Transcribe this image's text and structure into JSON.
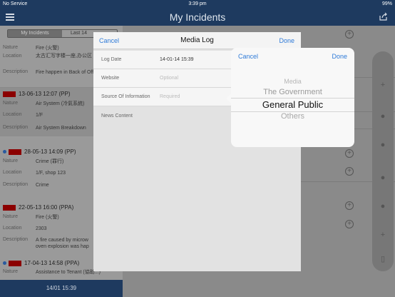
{
  "status": {
    "carrier": "No Service",
    "time": "3:39 pm",
    "battery": "99%"
  },
  "nav": {
    "title": "My Incidents"
  },
  "left": {
    "seg_a": "My Incidents",
    "seg_b": "Last 14",
    "footer": "14/01 15:39",
    "inc1": {
      "nature_label": "Nature",
      "nature": "Fire (火警)",
      "location_label": "Location",
      "location": "太古汇写字楼一座,办公区 百巷",
      "desc_label": "Description",
      "desc": "Fire happen in Back of Office Tower I"
    },
    "inc2": {
      "header": "13-06-13 12:07 (PP)",
      "nature_label": "Nature",
      "nature": "Air System (冷氣系統)",
      "location_label": "Location",
      "location": "1/F",
      "desc_label": "Description",
      "desc": "Air System Breakdown"
    },
    "grp1": "12",
    "inc3": {
      "header": "28-05-13 14:09 (PP)",
      "nature_label": "Nature",
      "nature": "Crime (罪行)",
      "location_label": "Location",
      "location": "1/F, shop 123",
      "desc_label": "Description",
      "desc": "Crime"
    },
    "grp2": "29",
    "inc4": {
      "header": "22-05-13 16:00 (PPA)",
      "nature_label": "Nature",
      "nature": "Fire (火警)",
      "location_label": "Location",
      "location": "2303",
      "desc_label": "Description",
      "desc": "A fire caused by microw oven explosion was hap"
    },
    "grp3": "17",
    "inc5": {
      "header": "17-04-13 14:58 (PPA)",
      "nature_label": "Nature",
      "nature": "Assistance to Tenant (協助...)"
    }
  },
  "modal": {
    "cancel": "Cancel",
    "title": "Media Log",
    "done": "Done",
    "log_date_label": "Log Date",
    "log_date": "14-01-14 15:39",
    "website_label": "Website",
    "website_placeholder": "Optional",
    "source_label": "Source Of Information",
    "source_placeholder": "Required",
    "news_label": "News Content"
  },
  "picker": {
    "cancel": "Cancel",
    "done": "Done",
    "options": [
      "Media",
      "The Government",
      "General Public",
      "Others"
    ],
    "selected": "General Public"
  },
  "colors": {
    "accent": "#2f7bd8",
    "navbar": "#1e3a5f",
    "flag": "#8b0000"
  }
}
